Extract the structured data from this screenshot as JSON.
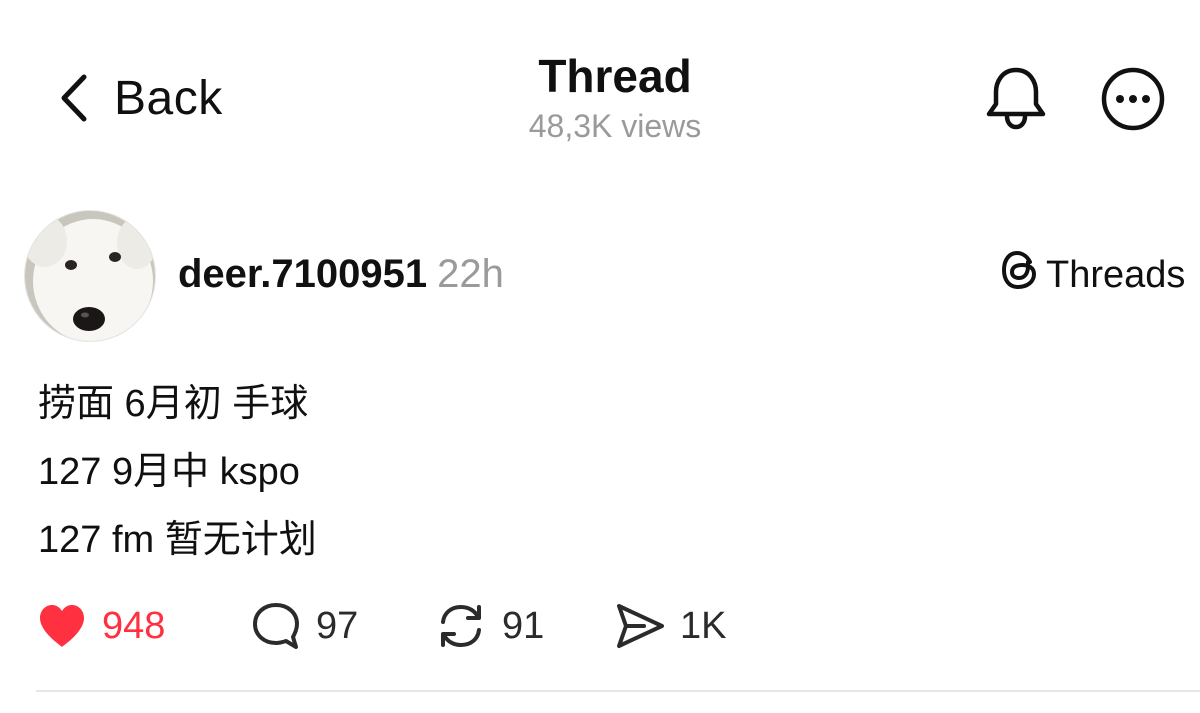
{
  "header": {
    "back_label": "Back",
    "title": "Thread",
    "views": "48,3K views",
    "icons": [
      "chevron-left-icon",
      "bell-icon",
      "more-icon"
    ]
  },
  "post": {
    "username": "deer.7100951",
    "time": "22h",
    "source_label": "Threads",
    "avatar_description_icon": "dog-avatar",
    "lines": [
      "捞面 6月初 手球",
      "127 9月中 kspo",
      "127 fm 暂无计划"
    ],
    "actions": {
      "likes": "948",
      "comments": "97",
      "reposts": "91",
      "shares": "1K"
    }
  },
  "colors": {
    "like": "#ff3040",
    "muted_text": "#9a9a9a",
    "divider": "#e6e6e6"
  }
}
